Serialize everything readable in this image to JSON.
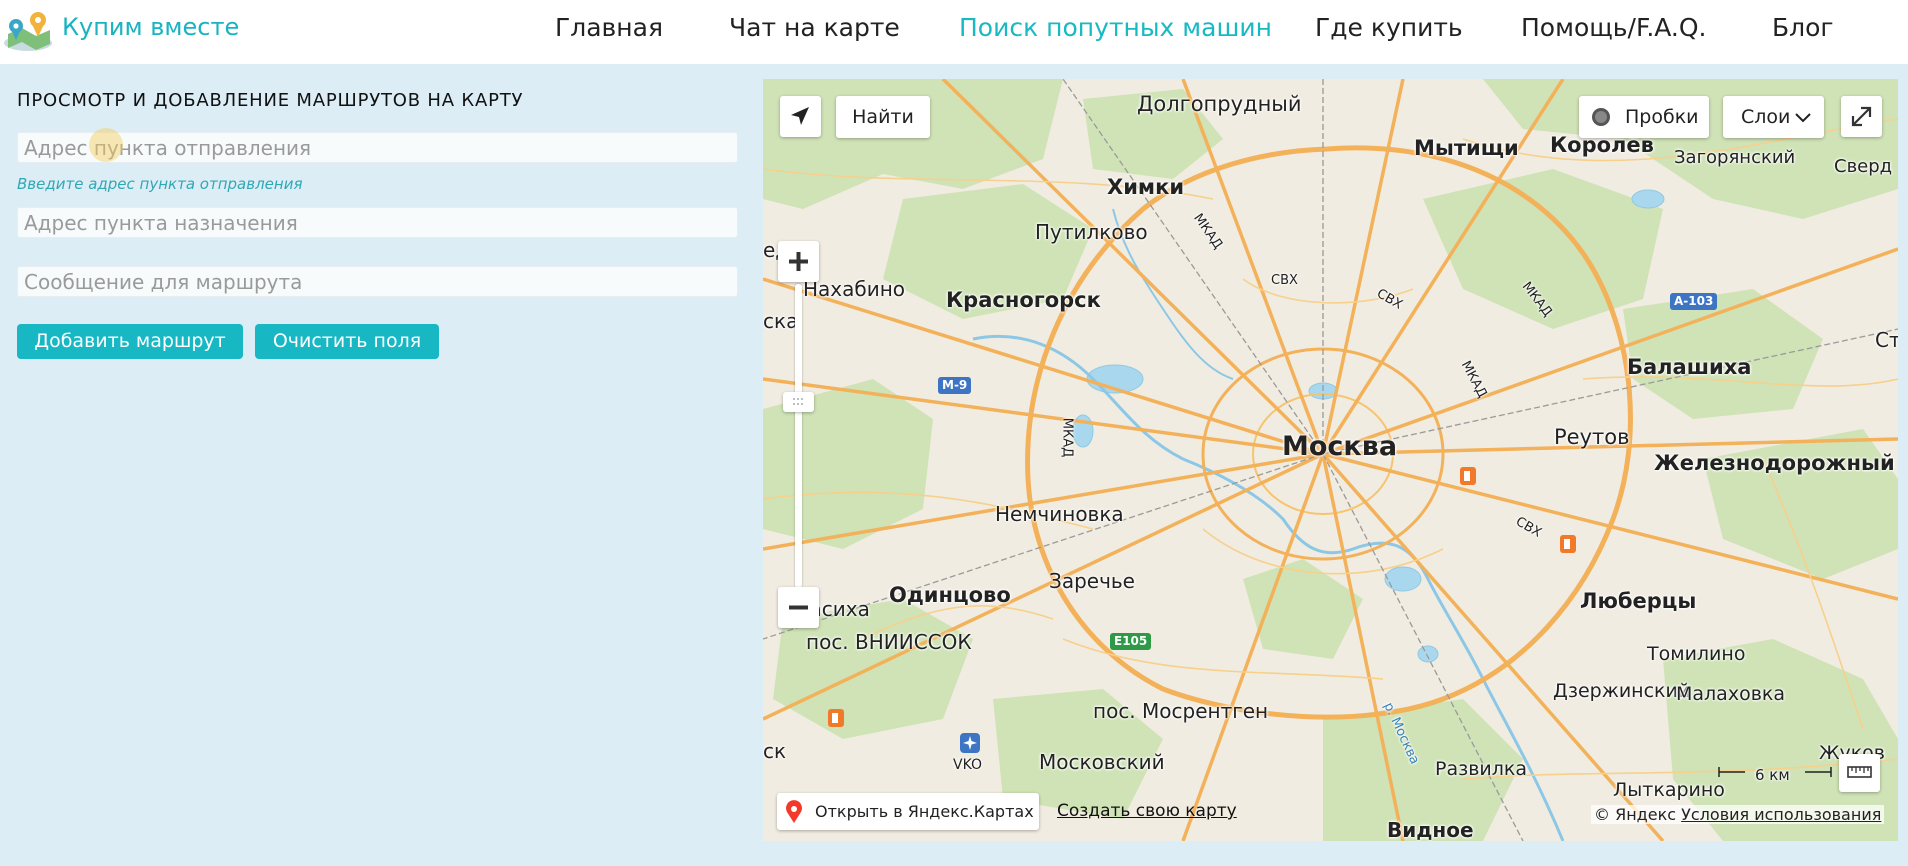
{
  "header": {
    "brand": "Купим вместе",
    "nav": [
      {
        "label": "Главная"
      },
      {
        "label": "Чат на карте"
      },
      {
        "label": "Поиск попутных машин",
        "active": true
      },
      {
        "label": "Где купить"
      },
      {
        "label": "Помощь/F.A.Q."
      },
      {
        "label": "Блог"
      }
    ]
  },
  "form": {
    "title": "ПРОСМОТР И ДОБАВЛЕНИЕ МАРШРУТОВ НА КАРТУ",
    "from_placeholder": "Адрес пункта отправления",
    "from_hint": "Введите адрес пункта отправления",
    "to_placeholder": "Адрес пункта назначения",
    "message_placeholder": "Сообщение для маршрута",
    "add_button": "Добавить маршрут",
    "clear_button": "Очистить поля"
  },
  "map": {
    "find_button": "Найти",
    "traffic_button": "Пробки",
    "layers_button": "Слои",
    "scale_label": "6 км",
    "open_in_yandex": "Открыть в Яндекс.Картах",
    "create_map": "Создать свою карту",
    "copyright": "© Яндекс",
    "terms": "Условия использования",
    "road_labels": [
      "М-9",
      "А-103",
      "E105",
      "МКАД",
      "МКАД",
      "МКАД",
      "МКАД",
      "СВХ",
      "СВХ",
      "СВХ",
      "р. Москва",
      "VKO"
    ],
    "places": [
      "Долгопрудный",
      "Мытищи",
      "Королёв",
      "Загорянский",
      "Сверд",
      "Химки",
      "Путилково",
      "ед",
      "Нахабино",
      "Красногорск",
      "ска",
      "Ст",
      "Балашиха",
      "Реутов",
      "Москва",
      "Железнодорожный",
      "Немчиновка",
      "Заречье",
      "Власиха",
      "Одинцово",
      "Люберцы",
      "пос. ВНИИССОК",
      "Томилино",
      "Дзержинский",
      "Малаховка",
      "пос. Мосрентген",
      "ск",
      "Жуков",
      "Московский",
      "Развилка",
      "Лыткарино",
      "Видное"
    ]
  }
}
